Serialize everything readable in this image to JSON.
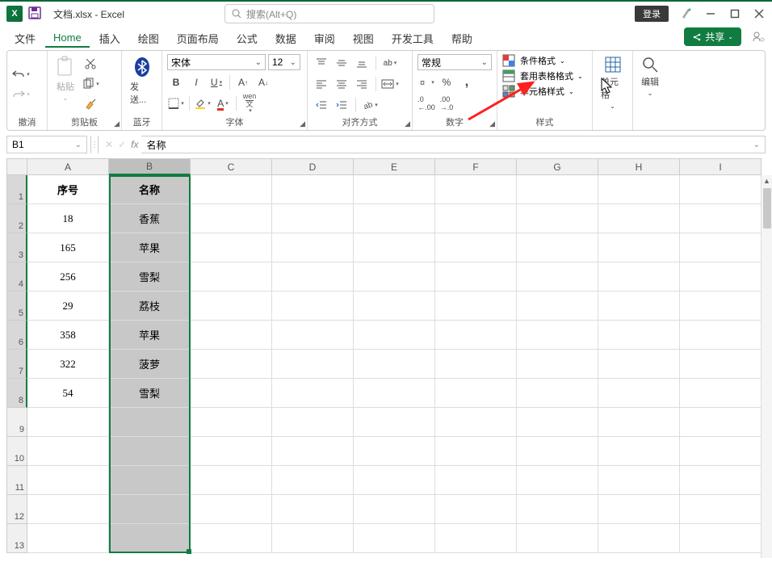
{
  "title_bar": {
    "save_icon": "save",
    "doc_title": "文档.xlsx - Excel",
    "search_placeholder": "搜索(Alt+Q)",
    "login_label": "登录"
  },
  "tabs": [
    "文件",
    "Home",
    "插入",
    "绘图",
    "页面布局",
    "公式",
    "数据",
    "审阅",
    "视图",
    "开发工具",
    "帮助"
  ],
  "active_tab_index": 1,
  "share_btn": "共享",
  "ribbon": {
    "undo_group": {
      "label": "撤消"
    },
    "clipboard_group": {
      "label": "剪贴板",
      "paste": "粘贴"
    },
    "bluetooth_group": {
      "label": "蓝牙",
      "send": "发送..."
    },
    "font_group": {
      "label": "字体",
      "font_name": "宋体",
      "font_size": "12",
      "bold": "B",
      "italic": "I",
      "underline": "U",
      "wen": "wen\n文"
    },
    "align_group": {
      "label": "对齐方式",
      "ab": "ab"
    },
    "number_group": {
      "label": "数字",
      "format": "常规"
    },
    "styles_group": {
      "label": "样式",
      "conditional": "条件格式",
      "table": "套用表格格式",
      "cell": "单元格样式"
    },
    "cells_group": {
      "label": "单元格"
    },
    "editing_group": {
      "label": "编辑"
    }
  },
  "formula_bar": {
    "name": "B1",
    "value": "名称"
  },
  "grid": {
    "col_letters": [
      "A",
      "B",
      "C",
      "D",
      "E",
      "F",
      "G",
      "H",
      "I"
    ],
    "row_numbers": [
      1,
      2,
      3,
      4,
      5,
      6,
      7,
      8,
      9,
      10,
      11,
      12,
      13
    ],
    "data": [
      {
        "a": "序号",
        "b": "名称"
      },
      {
        "a": "18",
        "b": "香蕉"
      },
      {
        "a": "165",
        "b": "苹果"
      },
      {
        "a": "256",
        "b": "雪梨"
      },
      {
        "a": "29",
        "b": "荔枝"
      },
      {
        "a": "358",
        "b": "苹果"
      },
      {
        "a": "322",
        "b": "菠萝"
      },
      {
        "a": "54",
        "b": "雪梨"
      }
    ],
    "selected_col": "B",
    "selected_cell": "B1"
  }
}
